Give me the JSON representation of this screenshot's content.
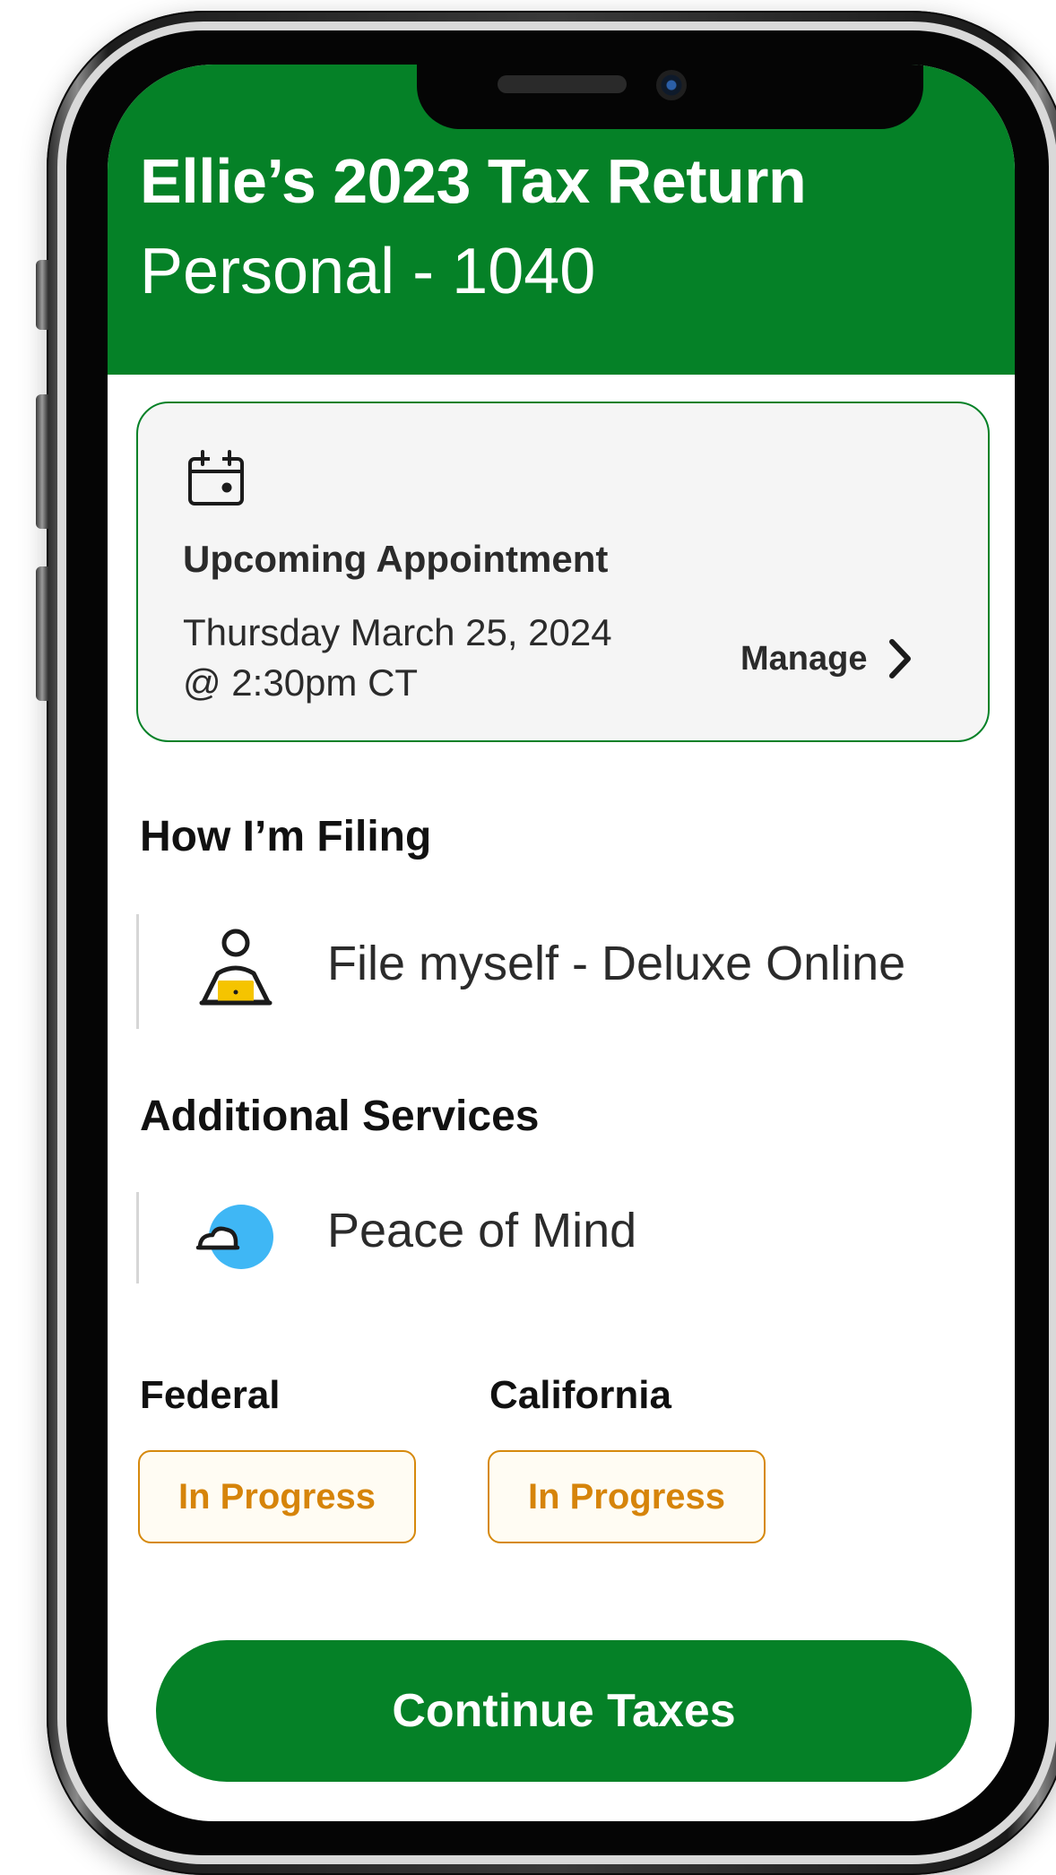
{
  "header": {
    "title": "Ellie’s 2023 Tax Return",
    "subtitle": "Personal - 1040"
  },
  "appointment": {
    "icon": "calendar-icon",
    "heading": "Upcoming Appointment",
    "date_line": "Thursday March 25, 2024",
    "time_line": "@ 2:30pm CT",
    "manage_label": "Manage",
    "manage_icon": "chevron-right-icon"
  },
  "filing": {
    "title": "How I’m Filing",
    "icon": "person-laptop-icon",
    "method": "File myself - Deluxe Online"
  },
  "services": {
    "title": "Additional Services",
    "icon": "peace-of-mind-icon",
    "items": [
      "Peace of Mind"
    ]
  },
  "status": {
    "federal_label": "Federal",
    "federal_status": "In Progress",
    "state_label": "California",
    "state_status": "In Progress"
  },
  "actions": {
    "continue_label": "Continue Taxes"
  },
  "colors": {
    "brand_green": "#058127",
    "status_orange": "#d6890d",
    "laptop_yellow": "#f5c400",
    "cloud_blue": "#3fb7f5"
  }
}
